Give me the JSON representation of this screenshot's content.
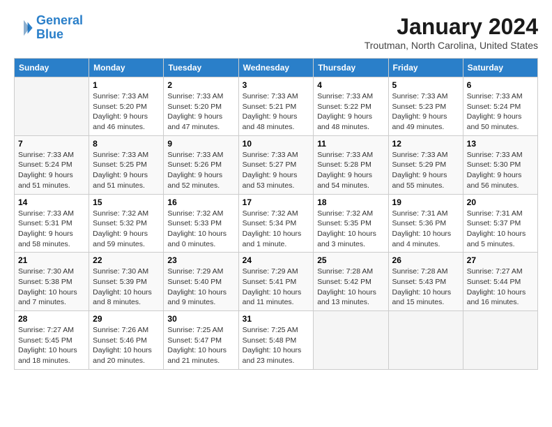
{
  "header": {
    "logo_general": "General",
    "logo_blue": "Blue",
    "month": "January 2024",
    "location": "Troutman, North Carolina, United States"
  },
  "weekdays": [
    "Sunday",
    "Monday",
    "Tuesday",
    "Wednesday",
    "Thursday",
    "Friday",
    "Saturday"
  ],
  "weeks": [
    [
      {
        "day": "",
        "sunrise": "",
        "sunset": "",
        "daylight": "",
        "empty": true
      },
      {
        "day": "1",
        "sunrise": "Sunrise: 7:33 AM",
        "sunset": "Sunset: 5:20 PM",
        "daylight": "Daylight: 9 hours and 46 minutes."
      },
      {
        "day": "2",
        "sunrise": "Sunrise: 7:33 AM",
        "sunset": "Sunset: 5:20 PM",
        "daylight": "Daylight: 9 hours and 47 minutes."
      },
      {
        "day": "3",
        "sunrise": "Sunrise: 7:33 AM",
        "sunset": "Sunset: 5:21 PM",
        "daylight": "Daylight: 9 hours and 48 minutes."
      },
      {
        "day": "4",
        "sunrise": "Sunrise: 7:33 AM",
        "sunset": "Sunset: 5:22 PM",
        "daylight": "Daylight: 9 hours and 48 minutes."
      },
      {
        "day": "5",
        "sunrise": "Sunrise: 7:33 AM",
        "sunset": "Sunset: 5:23 PM",
        "daylight": "Daylight: 9 hours and 49 minutes."
      },
      {
        "day": "6",
        "sunrise": "Sunrise: 7:33 AM",
        "sunset": "Sunset: 5:24 PM",
        "daylight": "Daylight: 9 hours and 50 minutes."
      }
    ],
    [
      {
        "day": "7",
        "sunrise": "Sunrise: 7:33 AM",
        "sunset": "Sunset: 5:24 PM",
        "daylight": "Daylight: 9 hours and 51 minutes."
      },
      {
        "day": "8",
        "sunrise": "Sunrise: 7:33 AM",
        "sunset": "Sunset: 5:25 PM",
        "daylight": "Daylight: 9 hours and 51 minutes."
      },
      {
        "day": "9",
        "sunrise": "Sunrise: 7:33 AM",
        "sunset": "Sunset: 5:26 PM",
        "daylight": "Daylight: 9 hours and 52 minutes."
      },
      {
        "day": "10",
        "sunrise": "Sunrise: 7:33 AM",
        "sunset": "Sunset: 5:27 PM",
        "daylight": "Daylight: 9 hours and 53 minutes."
      },
      {
        "day": "11",
        "sunrise": "Sunrise: 7:33 AM",
        "sunset": "Sunset: 5:28 PM",
        "daylight": "Daylight: 9 hours and 54 minutes."
      },
      {
        "day": "12",
        "sunrise": "Sunrise: 7:33 AM",
        "sunset": "Sunset: 5:29 PM",
        "daylight": "Daylight: 9 hours and 55 minutes."
      },
      {
        "day": "13",
        "sunrise": "Sunrise: 7:33 AM",
        "sunset": "Sunset: 5:30 PM",
        "daylight": "Daylight: 9 hours and 56 minutes."
      }
    ],
    [
      {
        "day": "14",
        "sunrise": "Sunrise: 7:33 AM",
        "sunset": "Sunset: 5:31 PM",
        "daylight": "Daylight: 9 hours and 58 minutes."
      },
      {
        "day": "15",
        "sunrise": "Sunrise: 7:32 AM",
        "sunset": "Sunset: 5:32 PM",
        "daylight": "Daylight: 9 hours and 59 minutes."
      },
      {
        "day": "16",
        "sunrise": "Sunrise: 7:32 AM",
        "sunset": "Sunset: 5:33 PM",
        "daylight": "Daylight: 10 hours and 0 minutes."
      },
      {
        "day": "17",
        "sunrise": "Sunrise: 7:32 AM",
        "sunset": "Sunset: 5:34 PM",
        "daylight": "Daylight: 10 hours and 1 minute."
      },
      {
        "day": "18",
        "sunrise": "Sunrise: 7:32 AM",
        "sunset": "Sunset: 5:35 PM",
        "daylight": "Daylight: 10 hours and 3 minutes."
      },
      {
        "day": "19",
        "sunrise": "Sunrise: 7:31 AM",
        "sunset": "Sunset: 5:36 PM",
        "daylight": "Daylight: 10 hours and 4 minutes."
      },
      {
        "day": "20",
        "sunrise": "Sunrise: 7:31 AM",
        "sunset": "Sunset: 5:37 PM",
        "daylight": "Daylight: 10 hours and 5 minutes."
      }
    ],
    [
      {
        "day": "21",
        "sunrise": "Sunrise: 7:30 AM",
        "sunset": "Sunset: 5:38 PM",
        "daylight": "Daylight: 10 hours and 7 minutes."
      },
      {
        "day": "22",
        "sunrise": "Sunrise: 7:30 AM",
        "sunset": "Sunset: 5:39 PM",
        "daylight": "Daylight: 10 hours and 8 minutes."
      },
      {
        "day": "23",
        "sunrise": "Sunrise: 7:29 AM",
        "sunset": "Sunset: 5:40 PM",
        "daylight": "Daylight: 10 hours and 9 minutes."
      },
      {
        "day": "24",
        "sunrise": "Sunrise: 7:29 AM",
        "sunset": "Sunset: 5:41 PM",
        "daylight": "Daylight: 10 hours and 11 minutes."
      },
      {
        "day": "25",
        "sunrise": "Sunrise: 7:28 AM",
        "sunset": "Sunset: 5:42 PM",
        "daylight": "Daylight: 10 hours and 13 minutes."
      },
      {
        "day": "26",
        "sunrise": "Sunrise: 7:28 AM",
        "sunset": "Sunset: 5:43 PM",
        "daylight": "Daylight: 10 hours and 15 minutes."
      },
      {
        "day": "27",
        "sunrise": "Sunrise: 7:27 AM",
        "sunset": "Sunset: 5:44 PM",
        "daylight": "Daylight: 10 hours and 16 minutes."
      }
    ],
    [
      {
        "day": "28",
        "sunrise": "Sunrise: 7:27 AM",
        "sunset": "Sunset: 5:45 PM",
        "daylight": "Daylight: 10 hours and 18 minutes."
      },
      {
        "day": "29",
        "sunrise": "Sunrise: 7:26 AM",
        "sunset": "Sunset: 5:46 PM",
        "daylight": "Daylight: 10 hours and 20 minutes."
      },
      {
        "day": "30",
        "sunrise": "Sunrise: 7:25 AM",
        "sunset": "Sunset: 5:47 PM",
        "daylight": "Daylight: 10 hours and 21 minutes."
      },
      {
        "day": "31",
        "sunrise": "Sunrise: 7:25 AM",
        "sunset": "Sunset: 5:48 PM",
        "daylight": "Daylight: 10 hours and 23 minutes."
      },
      {
        "day": "",
        "sunrise": "",
        "sunset": "",
        "daylight": "",
        "empty": true
      },
      {
        "day": "",
        "sunrise": "",
        "sunset": "",
        "daylight": "",
        "empty": true
      },
      {
        "day": "",
        "sunrise": "",
        "sunset": "",
        "daylight": "",
        "empty": true
      }
    ]
  ]
}
